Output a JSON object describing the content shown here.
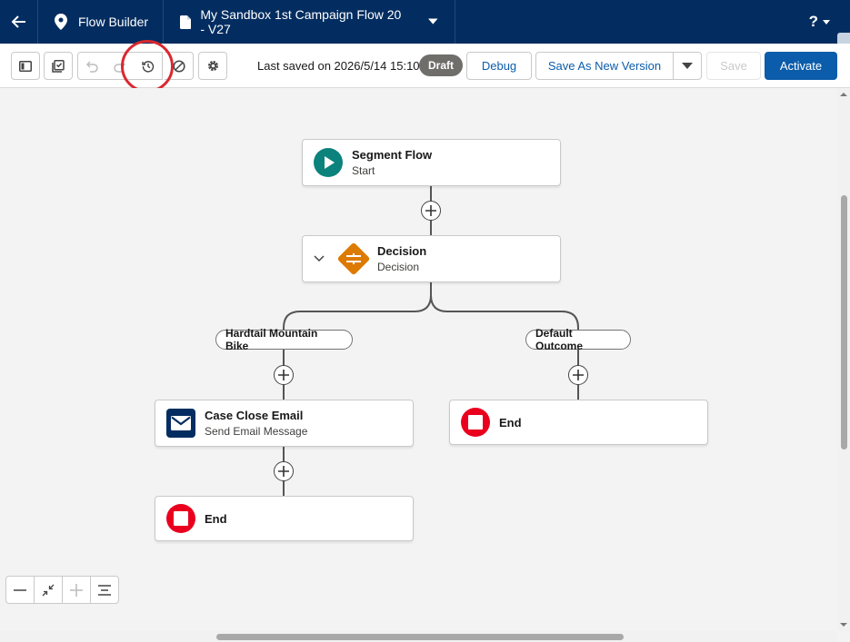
{
  "topbar": {
    "app_name": "Flow Builder",
    "flow_name": "My Sandbox 1st Campaign Flow 20 - V27",
    "help_label": "?"
  },
  "toolbar": {
    "last_saved": "Last saved on 2026/5/14 15:10",
    "status_badge": "Draft",
    "debug_label": "Debug",
    "save_as_new_label": "Save As New Version",
    "save_label": "Save",
    "activate_label": "Activate"
  },
  "nodes": {
    "start": {
      "title": "Segment Flow",
      "subtitle": "Start"
    },
    "decision": {
      "title": "Decision",
      "subtitle": "Decision"
    },
    "email": {
      "title": "Case Close Email",
      "subtitle": "Send Email Message"
    },
    "end_left": {
      "title": "End"
    },
    "end_right": {
      "title": "End"
    }
  },
  "outcomes": {
    "left": "Hardtail Mountain Bike",
    "right": "Default Outcome"
  },
  "colors": {
    "navy": "#032d60",
    "brand": "#0b5cab",
    "start_green": "#0b827c",
    "decision_orange": "#dd7a01",
    "email_navy": "#032d60",
    "end_red": "#ea001e",
    "highlight_red": "#d9292f"
  }
}
